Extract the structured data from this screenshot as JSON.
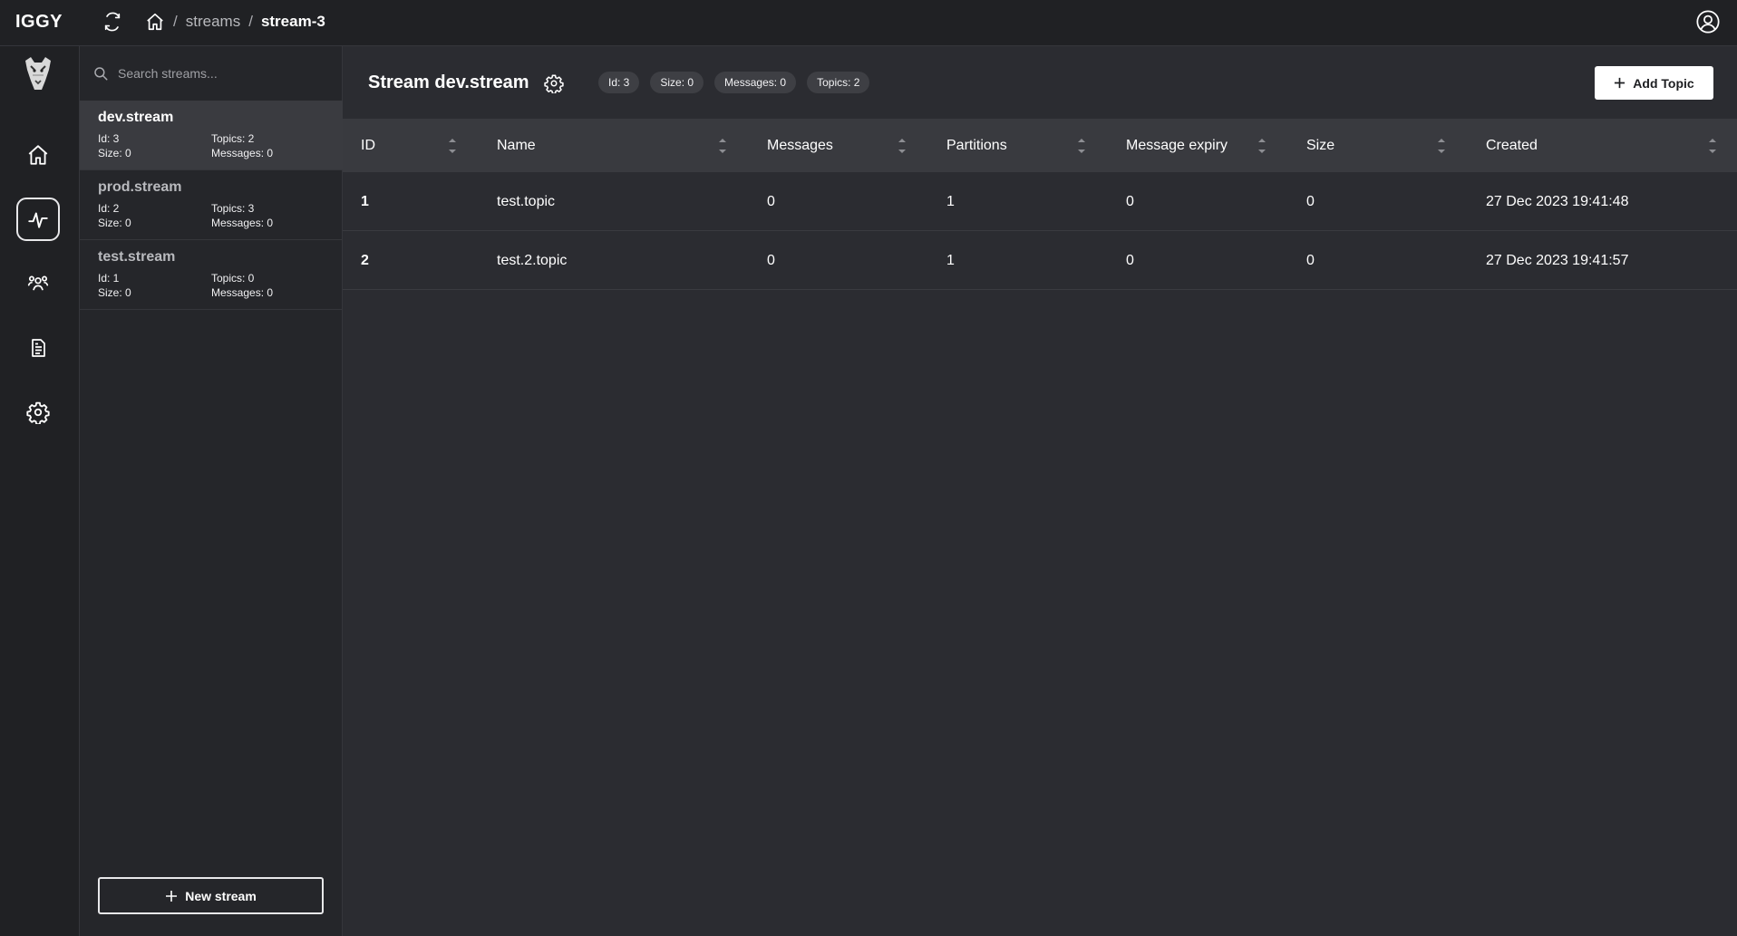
{
  "app": {
    "logo": "IGGY"
  },
  "breadcrumb": {
    "separator": "/",
    "streams": "streams",
    "current": "stream-3"
  },
  "search": {
    "placeholder": "Search streams..."
  },
  "streams": [
    {
      "name": "dev.stream",
      "id": "Id: 3",
      "topics": "Topics: 2",
      "size": "Size: 0",
      "messages": "Messages: 0",
      "active": true
    },
    {
      "name": "prod.stream",
      "id": "Id: 2",
      "topics": "Topics: 3",
      "size": "Size: 0",
      "messages": "Messages: 0",
      "active": false
    },
    {
      "name": "test.stream",
      "id": "Id: 1",
      "topics": "Topics: 0",
      "size": "Size: 0",
      "messages": "Messages: 0",
      "active": false
    }
  ],
  "new_stream_label": "New stream",
  "header": {
    "title": "Stream dev.stream",
    "badges": [
      "Id: 3",
      "Size: 0",
      "Messages: 0",
      "Topics: 2"
    ],
    "add_topic_label": "Add Topic"
  },
  "table": {
    "columns": [
      "ID",
      "Name",
      "Messages",
      "Partitions",
      "Message expiry",
      "Size",
      "Created"
    ],
    "rows": [
      [
        "1",
        "test.topic",
        "0",
        "1",
        "0",
        "0",
        "27 Dec 2023 19:41:48"
      ],
      [
        "2",
        "test.2.topic",
        "0",
        "1",
        "0",
        "0",
        "27 Dec 2023 19:41:57"
      ]
    ]
  },
  "colors": {
    "bg": "#2b2c31",
    "rail": "#202124",
    "panel": "#25262a",
    "active_row": "#3a3b40",
    "header_row": "#393a3f"
  },
  "icons": [
    "refresh-icon",
    "home-icon",
    "user-circle-icon",
    "mascot-logo",
    "dashboard-icon",
    "streams-icon",
    "users-icon",
    "logs-icon",
    "settings-icon",
    "search-icon",
    "plus-icon",
    "gear-icon",
    "sort-icon"
  ]
}
